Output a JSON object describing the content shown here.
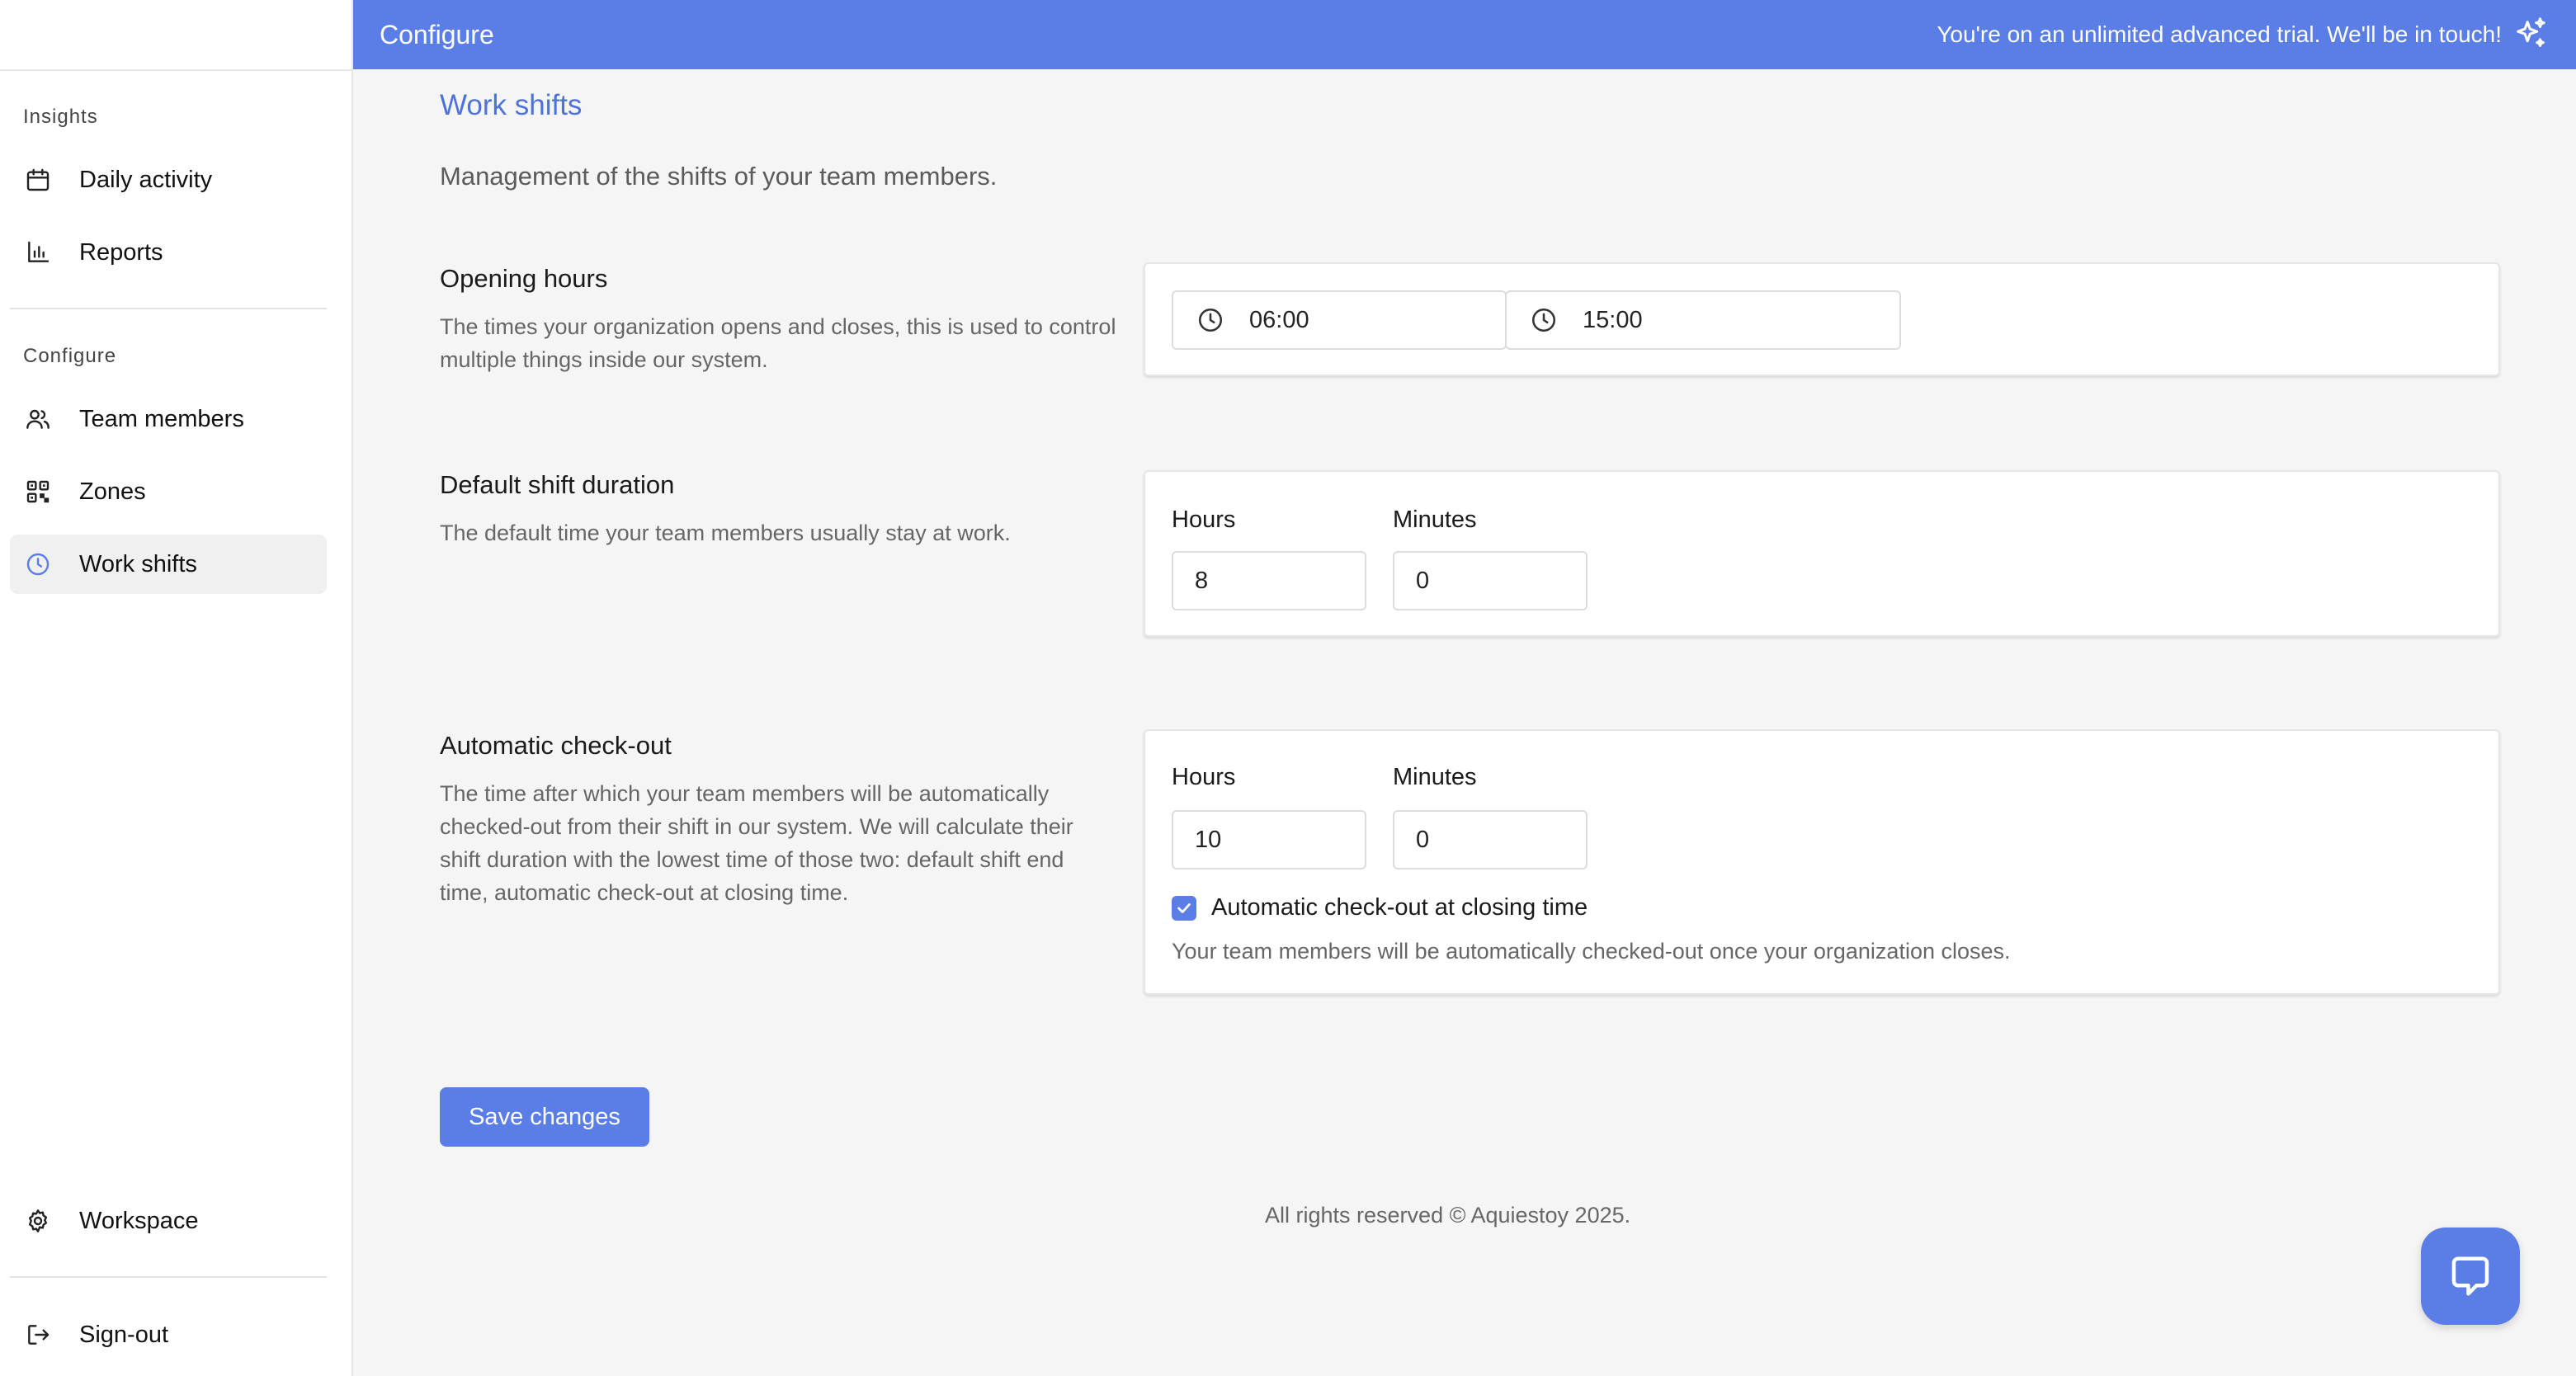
{
  "topbar": {
    "title": "Configure",
    "trial_message": "You're on an unlimited advanced trial. We'll be in touch!",
    "color": "#5a7ee6"
  },
  "sidebar": {
    "insights_label": "Insights",
    "insights_items": [
      {
        "label": "Daily activity",
        "icon": "calendar-icon"
      },
      {
        "label": "Reports",
        "icon": "bar-chart-icon"
      }
    ],
    "configure_label": "Configure",
    "configure_items": [
      {
        "label": "Team members",
        "icon": "users-icon"
      },
      {
        "label": "Zones",
        "icon": "qr-code-icon"
      },
      {
        "label": "Work shifts",
        "icon": "clock-icon",
        "active": true
      }
    ],
    "bottom_items": [
      {
        "label": "Workspace",
        "icon": "gear-icon"
      },
      {
        "label": "Sign-out",
        "icon": "sign-out-icon"
      }
    ]
  },
  "main": {
    "title": "Work shifts",
    "description": "Management of the shifts of your team members.",
    "opening_hours": {
      "title": "Opening hours",
      "description": "The times your organization opens and closes, this is used to control multiple things inside our system.",
      "open_time": "06:00",
      "close_time": "15:00"
    },
    "default_shift": {
      "title": "Default shift duration",
      "description": "The default time your team members usually stay at work.",
      "hours_label": "Hours",
      "minutes_label": "Minutes",
      "hours_value": "8",
      "minutes_value": "0"
    },
    "auto_checkout": {
      "title": "Automatic check-out",
      "description": "The time after which your team members will be automatically checked-out from their shift in our system. We will calculate their shift duration with the lowest time of those two: default shift end time, automatic check-out at closing time.",
      "hours_label": "Hours",
      "minutes_label": "Minutes",
      "hours_value": "10",
      "minutes_value": "0",
      "checkbox_label": "Automatic check-out at closing time",
      "checkbox_checked": true,
      "checkbox_help": "Your team members will be automatically checked-out once your organization closes."
    },
    "save_label": "Save changes",
    "footer": "All rights reserved © Aquiestoy 2025."
  }
}
